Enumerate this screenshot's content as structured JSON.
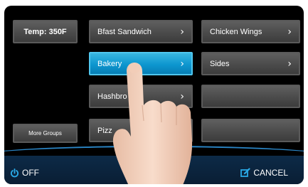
{
  "temp_button": {
    "label": "Temp: 350F"
  },
  "more_groups_button": {
    "label": "More Groups"
  },
  "menu_items": [
    {
      "label": "Bfast Sandwich",
      "chevron": "›"
    },
    {
      "label": "Chicken Wings",
      "chevron": "›"
    },
    {
      "label": "Bakery",
      "chevron": "›"
    },
    {
      "label": "Sides",
      "chevron": "›"
    },
    {
      "label": "Hashbro",
      "chevron": "›"
    },
    {
      "label": "Pizz",
      "chevron": "›"
    }
  ],
  "footer": {
    "off_label": "OFF",
    "cancel_label": "CANCEL"
  },
  "colors": {
    "accent": "#1aa6dc",
    "footer_bg": "#0c2a47",
    "button_bg": "#4b4b4b"
  }
}
